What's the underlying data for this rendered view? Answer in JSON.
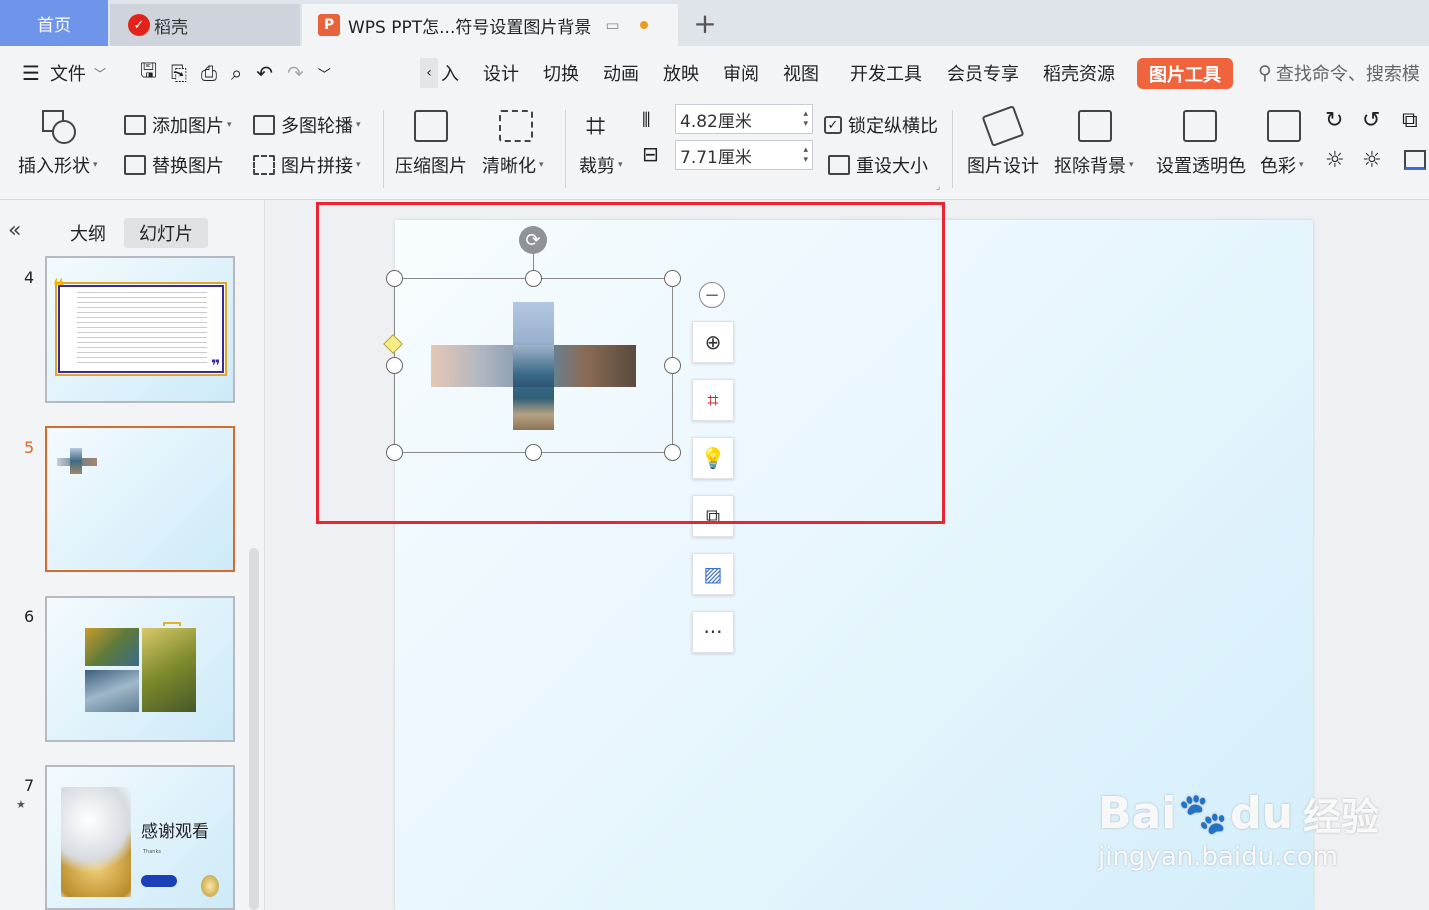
{
  "tabs": {
    "home": "首页",
    "daoke": "稻壳",
    "doc_title": "WPS PPT怎...符号设置图片背景",
    "new_tab": "+"
  },
  "menu": {
    "file": "文件",
    "items": [
      "入",
      "设计",
      "切换",
      "动画",
      "放映",
      "审阅",
      "视图",
      "开发工具",
      "会员专享",
      "稻壳资源"
    ],
    "picture_tools": "图片工具",
    "search_placeholder": "查找命令、搜索模"
  },
  "ribbon": {
    "insert_shape": "插入形状",
    "add_picture": "添加图片",
    "replace_picture": "替换图片",
    "multi_carousel": "多图轮播",
    "picture_collage": "图片拼接",
    "compress": "压缩图片",
    "clarify": "清晰化",
    "crop": "裁剪",
    "height_value": "4.82厘米",
    "width_value": "7.71厘米",
    "lock_ratio": "锁定纵横比",
    "reset_size": "重设大小",
    "picture_design": "图片设计",
    "remove_bg": "抠除背景",
    "set_transparent": "设置透明色",
    "color": "色彩"
  },
  "left_panel": {
    "outline_tab": "大纲",
    "slides_tab": "幻灯片",
    "slide_numbers": [
      "4",
      "5",
      "6",
      "7"
    ],
    "slide7_title": "感谢观看",
    "slide7_sub": "Thanks"
  },
  "watermark": {
    "brand": "Bai",
    "brand2": "du",
    "jingyan": "经验",
    "url": "jingyan.baidu.com"
  },
  "colors": {
    "accent": "#f0643d",
    "home_tab": "#6e95e9",
    "highlight": "#ea2430"
  }
}
